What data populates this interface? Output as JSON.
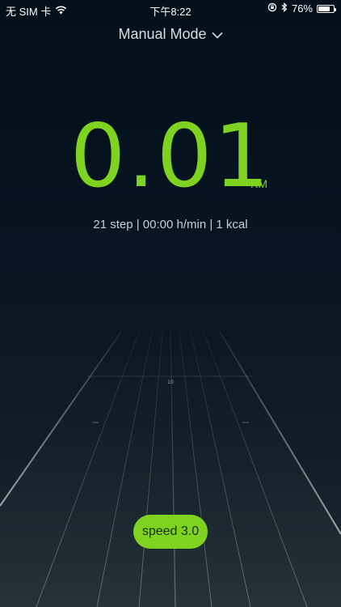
{
  "status_bar": {
    "carrier": "无 SIM 卡",
    "time": "下午8:22",
    "battery": "76%",
    "battery_level": 0.76
  },
  "mode_selector": {
    "label": "Manual Mode"
  },
  "distance": {
    "value": "0.01",
    "unit": "KM"
  },
  "stats": {
    "line": "21 step | 00:00 h/min | 1 kcal"
  },
  "track": {
    "marker": "10"
  },
  "speed": {
    "label": "speed 3.0"
  },
  "colors": {
    "accent": "#7ed321",
    "background": "#03101a"
  }
}
